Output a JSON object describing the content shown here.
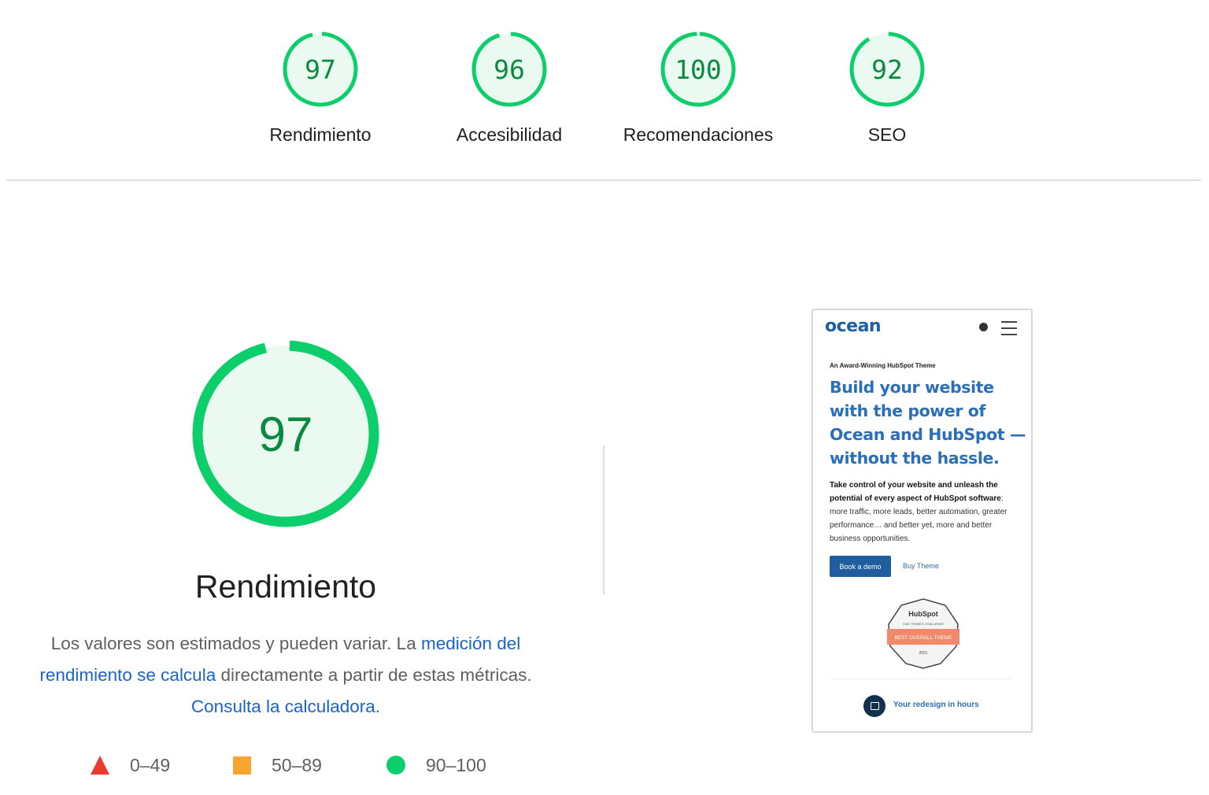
{
  "categories": [
    {
      "label": "Rendimiento",
      "score": 97
    },
    {
      "label": "Accesibilidad",
      "score": 96
    },
    {
      "label": "Recomendaciones",
      "score": 100
    },
    {
      "label": "SEO",
      "score": 92
    }
  ],
  "main": {
    "score": 97,
    "title": "Rendimiento",
    "desc_text1": "Los valores son estimados y pueden variar. La ",
    "desc_link1": "medición del rendimiento se calcula",
    "desc_text2": " directamente a partir de estas métricas. ",
    "desc_link2": "Consulta la calculadora."
  },
  "legend": [
    {
      "shape": "triangle",
      "color": "#eb3b30",
      "range": "0–49"
    },
    {
      "shape": "square",
      "color": "#f7a530",
      "range": "50–89"
    },
    {
      "shape": "circle",
      "color": "#0cce6b",
      "range": "90–100"
    }
  ],
  "colors": {
    "pass": "#0cce6b",
    "pass_text": "#0b8a3f",
    "pass_bg": "#eafaf1",
    "link": "#1a63c9"
  },
  "screenshot": {
    "logo": "ocean",
    "kicker": "An Award-Winning HubSpot Theme",
    "headline": "Build your website with the power of Ocean and HubSpot —without the hassle.",
    "body_bold": "Take control of your website and unleash the potential of every aspect of HubSpot software",
    "body_rest": ": more traffic, more leads, better automation, greater performance… and better yet, more and better business opportunities.",
    "primary_button": "Book a demo",
    "secondary_link": "Buy Theme",
    "badge_brand": "HubSpot",
    "badge_sub": "CMS THEMES CHALLENGE",
    "badge_ribbon": "BEST OVERALL THEME",
    "badge_year": "2021",
    "bar_text": "Your redesign in hours"
  }
}
